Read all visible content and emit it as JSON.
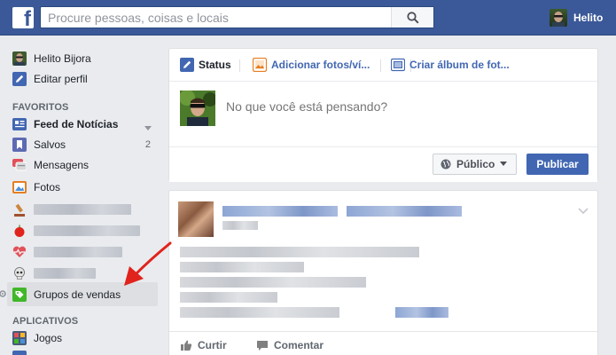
{
  "topbar": {
    "logo": "f",
    "search_placeholder": "Procure pessoas, coisas e locais",
    "user_name": "Helito"
  },
  "sidebar": {
    "profile": {
      "name": "Helito Bijora",
      "edit": "Editar perfil"
    },
    "favorites_title": "FAVORITOS",
    "favorites": [
      {
        "label": "Feed de Notícias",
        "icon": "news-feed-icon"
      },
      {
        "label": "Salvos",
        "icon": "bookmark-icon",
        "count": "2"
      },
      {
        "label": "Mensagens",
        "icon": "messages-icon"
      },
      {
        "label": "Fotos",
        "icon": "photos-icon"
      }
    ],
    "highlighted": {
      "label": "Grupos de vendas",
      "icon": "sale-tag-icon"
    },
    "apps_title": "APLICATIVOS",
    "apps": [
      {
        "label": "Jogos",
        "icon": "games-icon"
      }
    ]
  },
  "composer": {
    "tabs": [
      {
        "label": "Status",
        "icon": "pencil-icon"
      },
      {
        "label": "Adicionar fotos/ví...",
        "icon": "photo-add-icon"
      },
      {
        "label": "Criar álbum de fot...",
        "icon": "album-icon"
      }
    ],
    "placeholder": "No que você está pensando?",
    "privacy": "Público",
    "publish": "Publicar"
  },
  "post": {
    "actions": [
      {
        "label": "Curtir",
        "icon": "like-icon"
      },
      {
        "label": "Comentar",
        "icon": "comment-icon"
      }
    ]
  },
  "colors": {
    "brand": "#3b5998",
    "accent": "#4267b2",
    "arrow": "#e0231c"
  }
}
